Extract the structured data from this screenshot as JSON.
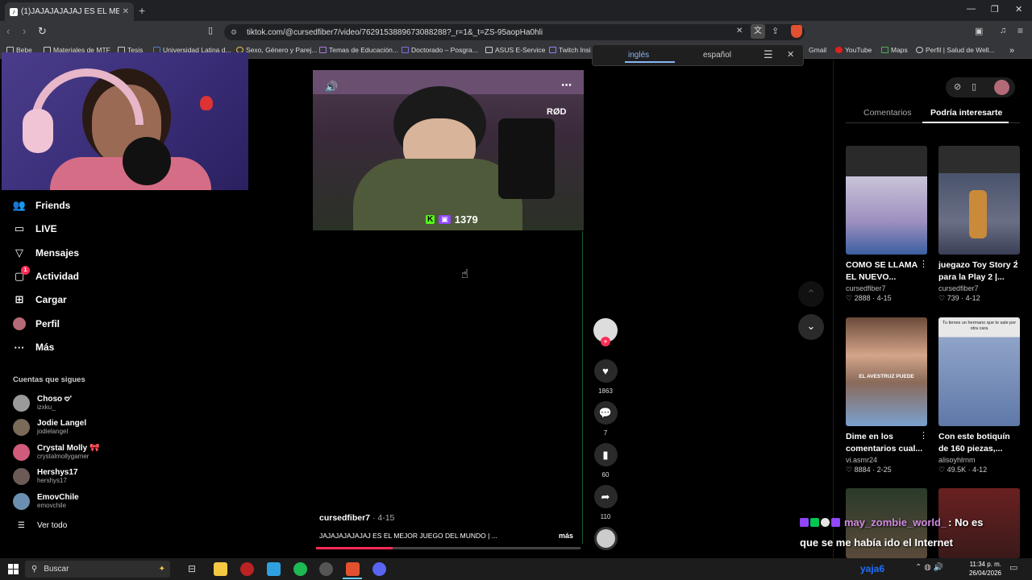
{
  "browser": {
    "tab_title": "(1)JAJAJAJAJAJ ES EL MEJ",
    "tab_favicon": "tiktok-icon",
    "url": "tiktok.com/@cursedfiber7/video/7629153889673088288?_r=1&_t=ZS-95aopHa0hli",
    "bookmarks": [
      "Bebe",
      "Materiales de MTF",
      "Tesis",
      "Universidad Latina d...",
      "Sexo, Género y Parej...",
      "Temas de Educación...",
      "Doctorado – Posgra...",
      "ASUS E-Service",
      "Twitch Insi",
      "Gmail",
      "YouTube",
      "Maps",
      "Perfil | Salud de Well..."
    ]
  },
  "translate": {
    "lang_from": "inglés",
    "lang_to": "español"
  },
  "sidebar": {
    "items": [
      {
        "label": "Friends",
        "icon": "friends-icon"
      },
      {
        "label": "LIVE",
        "icon": "live-icon"
      },
      {
        "label": "Mensajes",
        "icon": "messages-icon"
      },
      {
        "label": "Actividad",
        "icon": "activity-icon"
      },
      {
        "label": "Cargar",
        "icon": "upload-icon"
      },
      {
        "label": "Perfil",
        "icon": "profile-avatar"
      },
      {
        "label": "Más",
        "icon": "more-icon"
      }
    ],
    "activity_badge": "1",
    "following_heading": "Cuentas que sigues",
    "following": [
      {
        "name": "Choso 𖹭'",
        "user": "izxku_",
        "color": "#9a9a9a"
      },
      {
        "name": "Jodie Langel",
        "user": "jodielangel",
        "color": "#7a6a5a"
      },
      {
        "name": "Crystal Molly 🎀",
        "user": "crystalmollygamer",
        "color": "#d05b7a"
      },
      {
        "name": "Hershys17",
        "user": "hershys17",
        "color": "#6b5a55"
      },
      {
        "name": "EmovChile",
        "user": "emovchile",
        "color": "#6b8fb0"
      }
    ],
    "see_all": "Ver todo"
  },
  "video": {
    "overlay_count": "1379",
    "author": "cursedfiber7",
    "date": "4-15",
    "caption": "JAJAJAJAJAJAJ ES EL MEJOR JUEGO DEL MUNDO | ...",
    "more": "más",
    "progress": 0.29
  },
  "actions": {
    "likes": "1863",
    "comments": "7",
    "saves": "60",
    "shares": "110"
  },
  "right_panel": {
    "tabs": [
      "Comentarios",
      "Podría interesarte"
    ],
    "active_tab": 1,
    "cards": [
      {
        "title": "COMO SE LLAMA EL NUEVO...",
        "user": "cursedfiber7",
        "likes": "2888",
        "date": "4-15"
      },
      {
        "title": "juegazo Toy Story 2 para la Play 2 |...",
        "user": "cursedfiber7",
        "likes": "739",
        "date": "4-12"
      },
      {
        "title": "Dime en los comentarios cual...",
        "user": "vi.asmr24",
        "likes": "8884",
        "date": "2-25"
      },
      {
        "title": "Con este botiquín de 160 piezas,...",
        "user": "alisoyhlrnm",
        "likes": "49.5K",
        "date": "4-12"
      }
    ],
    "card2_overlay": "EL AVESTRUZ PUEDE",
    "card3_overlay": "Tu tienes un hermano que te sale por otra cara"
  },
  "stream_chat": {
    "username": "may_zombie_world_",
    "message_line1": ": No es",
    "message_line2": "que se me había ido el Internet",
    "next_user": "yaja6"
  },
  "taskbar": {
    "search_placeholder": "Buscar",
    "time": "11:34 p. m.",
    "date": "26/04/2026"
  }
}
